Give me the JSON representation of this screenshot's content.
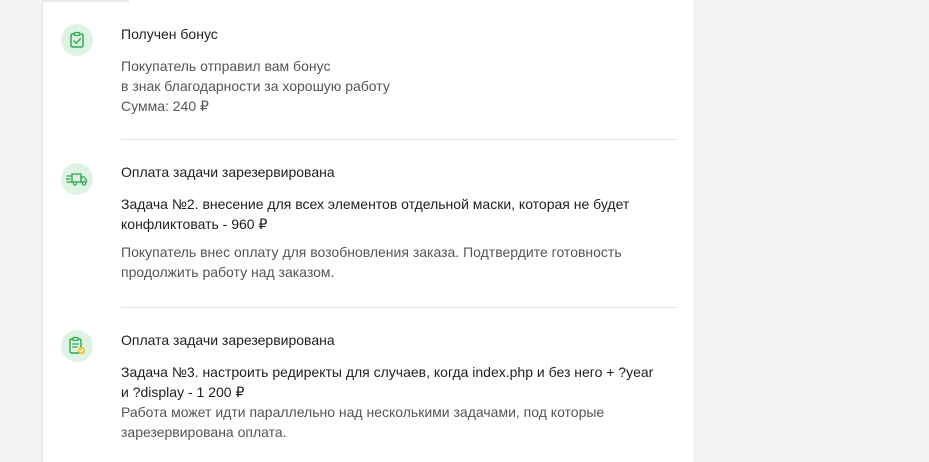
{
  "events": [
    {
      "icon": "clipboard-check-icon",
      "title": "Получен бонус",
      "lines": [
        "Покупатель отправил вам бонус",
        "в знак благодарности за хорошую работу",
        "Сумма: 240 ₽"
      ]
    },
    {
      "icon": "delivery-truck-icon",
      "title": "Оплата задачи зарезервирована",
      "task_lines": [
        "Задача №2. внесение для всех элементов отдельной маски, которая не будет",
        "конфликтовать - 960 ₽"
      ],
      "description_lines": [
        "Покупатель внес оплату для возобновления заказа. Подтвердите готовность",
        "продолжить работу над заказом."
      ]
    },
    {
      "icon": "clipboard-approved-icon",
      "title": "Оплата задачи зарезервирована",
      "task_lines": [
        "Задача №3. настроить редиректы для случаев, когда index.php и без него + ?year",
        "и ?display - 1 200 ₽"
      ],
      "description_lines": [
        "Работа может идти параллельно над несколькими задачами, под которые",
        "зарезервирована оплата."
      ]
    }
  ],
  "colors": {
    "icon_bg": "#dff3e4",
    "icon_stroke": "#2aa84a",
    "badge": "#f3c23a"
  }
}
